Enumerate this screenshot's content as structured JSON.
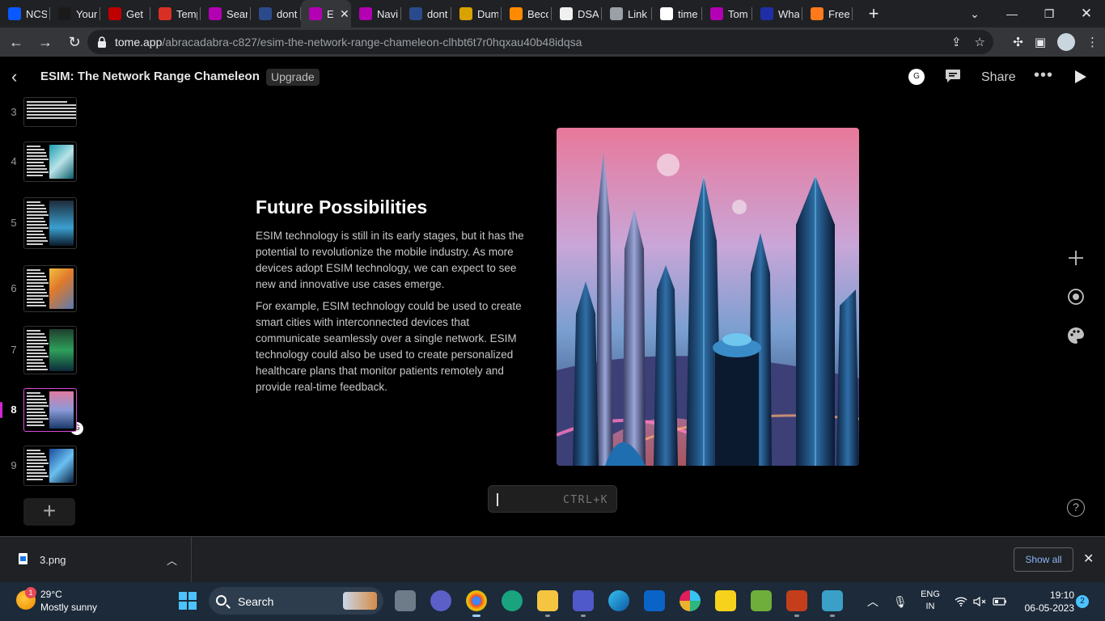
{
  "browser": {
    "tabs": [
      {
        "title": "NCS",
        "icon": "ncs-favicon",
        "color": "#0a58ff"
      },
      {
        "title": "Your",
        "icon": "si-favicon",
        "color": "#1a1a1a"
      },
      {
        "title": "Get",
        "icon": "red-logo-favicon",
        "color": "#c00000"
      },
      {
        "title": "Temp",
        "icon": "mail-favicon",
        "color": "#d93025"
      },
      {
        "title": "Sear",
        "icon": "tome-favicon",
        "color": "#b300b3"
      },
      {
        "title": "dont",
        "icon": "pt-favicon",
        "color": "#2b4a8b"
      },
      {
        "title": "E",
        "icon": "tome-favicon",
        "color": "#b300b3",
        "active": true
      },
      {
        "title": "Navi",
        "icon": "tome-favicon",
        "color": "#b300b3"
      },
      {
        "title": "dont",
        "icon": "pt-favicon",
        "color": "#2b4a8b"
      },
      {
        "title": "Dum",
        "icon": "crown-favicon",
        "color": "#d8a300"
      },
      {
        "title": "Beco",
        "icon": "becoming-favicon",
        "color": "#ff8a00"
      },
      {
        "title": "DSA",
        "icon": "github-favicon",
        "color": "#f0f0f0"
      },
      {
        "title": "Link",
        "icon": "globe-favicon",
        "color": "#9aa0a6"
      },
      {
        "title": "time",
        "icon": "google-favicon",
        "color": "#ffffff"
      },
      {
        "title": "Tom",
        "icon": "tome-favicon",
        "color": "#b300b3"
      },
      {
        "title": "Wha",
        "icon": "wha-favicon",
        "color": "#1f2ea6"
      },
      {
        "title": "Free",
        "icon": "box-favicon",
        "color": "#ff7a1a"
      }
    ],
    "url_host": "tome.app",
    "url_path": "/abracadabra-c827/esim-the-network-range-chameleon-clhbt6t7r0hqxau40b48idqsa"
  },
  "app": {
    "doc_title": "ESIM: The Network Range Chameleon",
    "upgrade_label": "Upgrade",
    "avatar_initial": "G",
    "share_label": "Share",
    "more_label": "•••"
  },
  "sidebar": {
    "slides": [
      {
        "number": "3",
        "image": "none"
      },
      {
        "number": "4",
        "image": "chip"
      },
      {
        "number": "5",
        "image": "person"
      },
      {
        "number": "6",
        "image": "circuit"
      },
      {
        "number": "7",
        "image": "shield"
      },
      {
        "number": "8",
        "image": "city",
        "active": true
      },
      {
        "number": "9",
        "image": "orbs"
      }
    ],
    "presence_initial": "G"
  },
  "slide": {
    "title": "Future Possibilities",
    "paragraph_1": "ESIM technology is still in its early stages, but it has the potential to revolutionize the mobile industry. As more devices adopt ESIM technology, we can expect to see new and innovative use cases emerge.",
    "paragraph_2": "For example, ESIM technology could be used to create smart cities with interconnected devices that communicate seamlessly over a single network. ESIM technology could also be used to create personalized healthcare plans that monitor patients remotely and provide real-time feedback.",
    "image": "futuristic-city-skyline"
  },
  "command_bar": {
    "hint": "CTRL+K"
  },
  "help_label": "?",
  "downloads": {
    "file_name": "3.png",
    "show_all_label": "Show all"
  },
  "taskbar": {
    "weather_temp": "29°C",
    "weather_desc": "Mostly sunny",
    "weather_badge": "1",
    "search_label": "Search",
    "lang_line1": "ENG",
    "lang_line2": "IN",
    "time": "19:10",
    "date": "06-05-2023",
    "notification_count": "2"
  }
}
